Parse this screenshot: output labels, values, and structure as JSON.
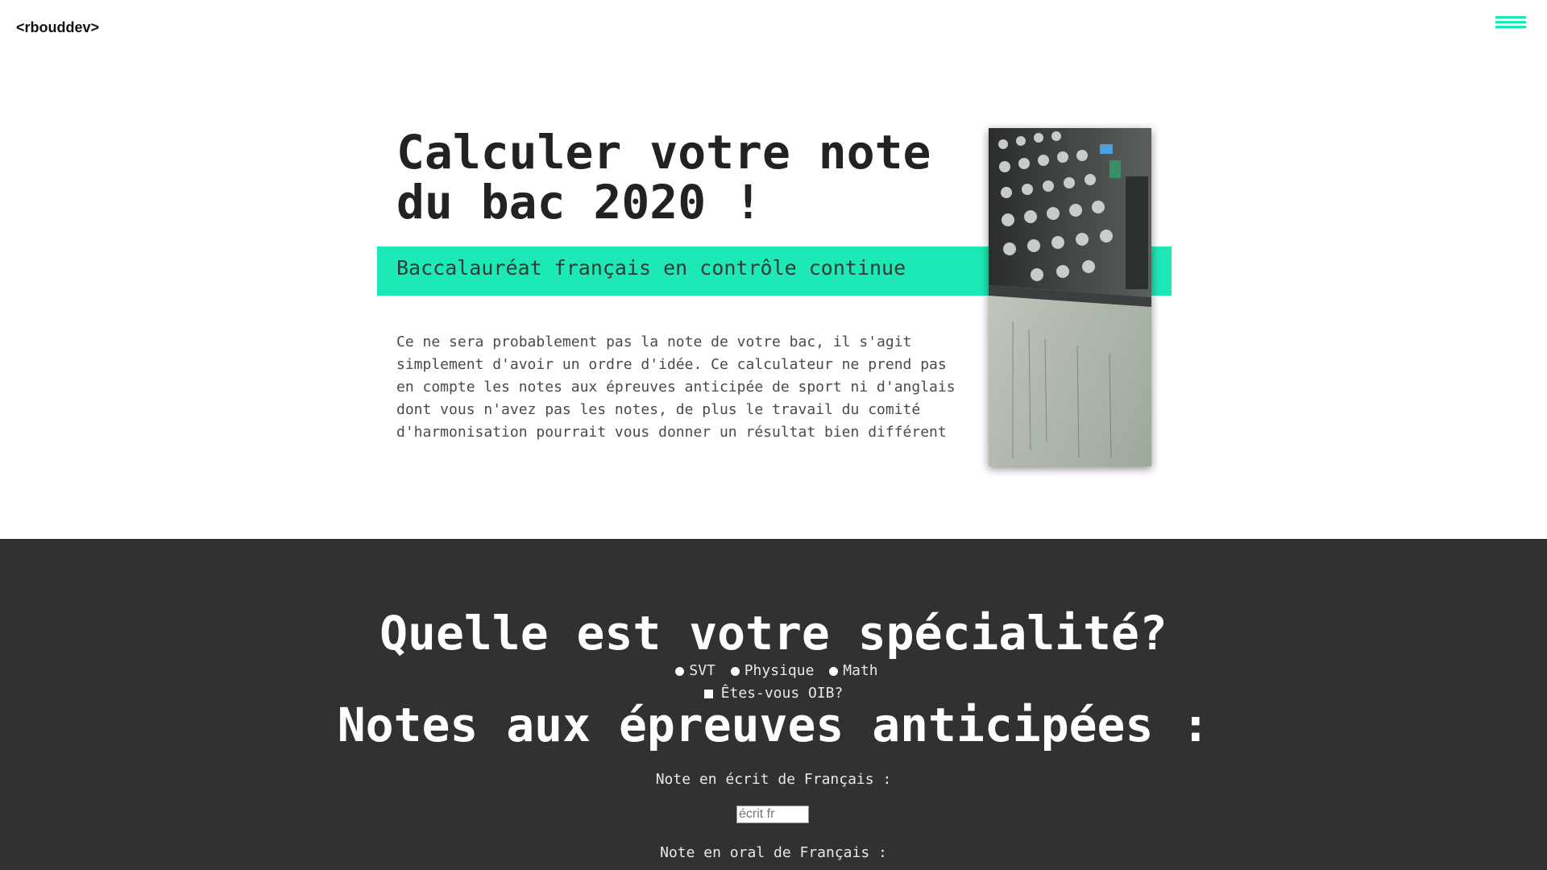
{
  "header": {
    "logo": "<rbouddev>",
    "menu_icon": "hamburger-menu-icon"
  },
  "hero": {
    "title": "Calculer votre note du bac 2020 !",
    "subtitle": "Baccalauréat français en contrôle continue",
    "description": "Ce ne sera probablement pas la note de votre bac, il s'agit simplement d'avoir un ordre d'idée. Ce calculateur ne prend pas en compte les notes aux épreuves anticipée de sport ni d'anglais dont vous n'avez pas les notes, de plus le travail du comité d'harmonisation pourrait vous donner un résultat bien différent",
    "image": "calculator-photo"
  },
  "specialite": {
    "title": "Quelle est votre spécialité?",
    "options": [
      "SVT",
      "Physique",
      "Math"
    ],
    "oib_label": "Êtes-vous OIB?"
  },
  "anticipees": {
    "title": "Notes aux épreuves anticipées :",
    "ecrit_label": "Note en écrit de Français :",
    "ecrit_placeholder": "écrit fr",
    "oral_label": "Note en oral de Français :"
  },
  "colors": {
    "accent": "#1de9b6",
    "dark_section": "#313131"
  }
}
